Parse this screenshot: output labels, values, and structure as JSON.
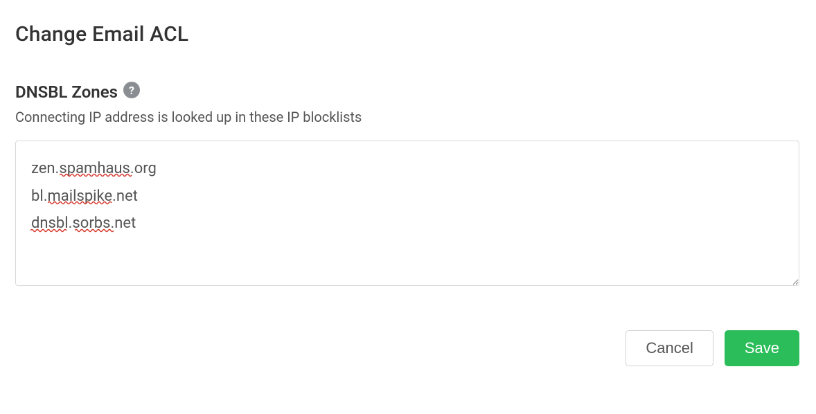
{
  "page": {
    "title": "Change Email ACL"
  },
  "section": {
    "title": "DNSBL Zones",
    "help_icon_title": "Help",
    "description": "Connecting IP address is looked up in these IP blocklists"
  },
  "form": {
    "zones_value": "zen.spamhaus.org\nbl.mailspike.net\ndnsbl.sorbs.net"
  },
  "buttons": {
    "cancel": "Cancel",
    "save": "Save"
  }
}
